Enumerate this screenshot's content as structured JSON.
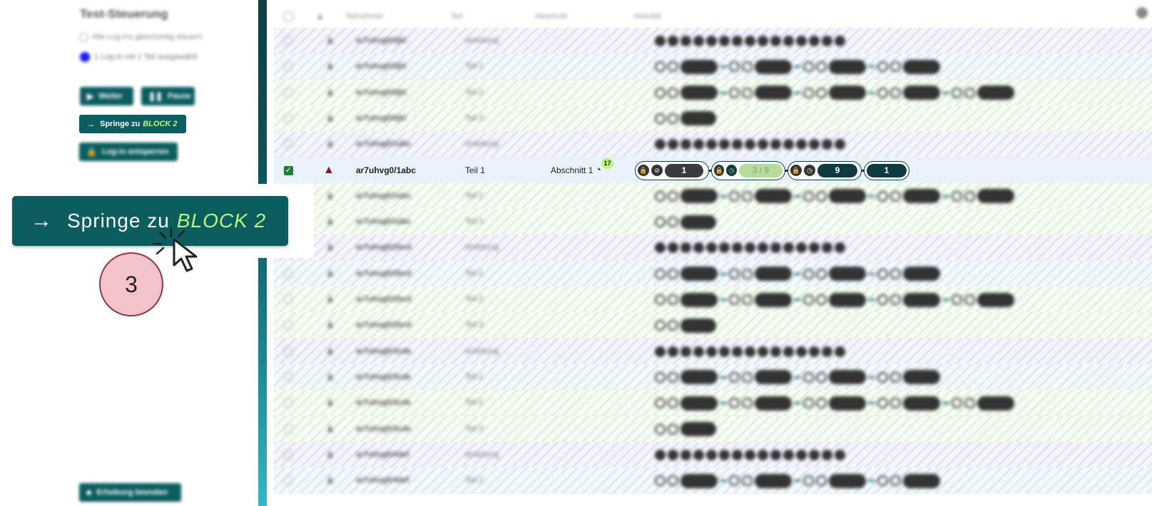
{
  "sidebar": {
    "title": "Test-Steuerung",
    "check_all_label": "Alle Log-ins gleichzeitig steuern",
    "selection_label": "1 Log-in mit 1 Teil ausgewählt",
    "buttons": {
      "weiter": "Weiter",
      "pause": "Pause",
      "springe_prefix": "Springe zu",
      "springe_target": "BLOCK 2",
      "login_entsperren": "Log-in entsperren",
      "erhebung_beenden": "Erhebung beenden"
    }
  },
  "table": {
    "headers": [
      "Teilnehmer",
      "Teil",
      "Abschnitt",
      "Aktivität"
    ],
    "rows": [
      {
        "name": "ar7uhvg0/0jkl",
        "teil": "einleitung"
      },
      {
        "name": "ar7uhvg0/0jkl",
        "teil": "Teil 1"
      },
      {
        "name": "ar7uhvg0/0jkl",
        "teil": "Teil 2"
      },
      {
        "name": "ar7uhvg0/0jkl",
        "teil": "Teil 3"
      },
      {
        "name": "ar7uhvg0/1abc",
        "teil": "einleitung"
      },
      {
        "name": "ar7uhvg0/1abc",
        "teil": "Teil 2"
      },
      {
        "name": "ar7uhvg0/1abc",
        "teil": "Teil 3"
      },
      {
        "name": "ar7uhvg0/2bcd",
        "teil": "einleitung"
      },
      {
        "name": "ar7uhvg0/2bcd",
        "teil": "Teil 1"
      },
      {
        "name": "ar7uhvg0/2bcd",
        "teil": "Teil 2"
      },
      {
        "name": "ar7uhvg0/2bcd",
        "teil": "Teil 3"
      },
      {
        "name": "ar7uhvg0/3cde",
        "teil": "einleitung"
      },
      {
        "name": "ar7uhvg0/3cde",
        "teil": "Teil 1"
      },
      {
        "name": "ar7uhvg0/3cde",
        "teil": "Teil 2"
      },
      {
        "name": "ar7uhvg0/3cde",
        "teil": "Teil 3"
      },
      {
        "name": "ar7uhvg0/4def",
        "teil": "einleitung"
      },
      {
        "name": "ar7uhvg0/4def",
        "teil": "Teil 1"
      }
    ],
    "active_row": {
      "name": "ar7uhvg0/1abc",
      "teil": "Teil 1",
      "abschnitt": "Abschnitt 1",
      "timer_badge": "17",
      "blocks": [
        {
          "value": "1",
          "state": "done"
        },
        {
          "value": "3 / 9",
          "state": "current"
        },
        {
          "value": "9",
          "state": "locked"
        },
        {
          "value": "1",
          "state": "open"
        }
      ]
    }
  },
  "callout": {
    "button_prefix": "Springe zu",
    "button_target": "BLOCK 2",
    "step_number": "3",
    "arrow_icon": "arrow-right-icon"
  },
  "colors": {
    "primary": "#0b5d5f",
    "accent_green": "#b8f57a",
    "block_dark": "#0e3b3f",
    "warning": "#7a1f2b",
    "step_circle": "#f4c2ca"
  }
}
